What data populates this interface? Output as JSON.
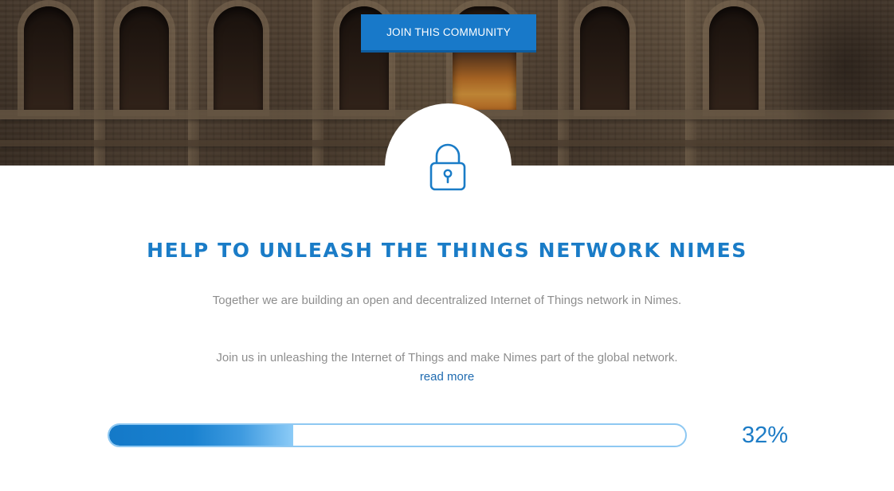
{
  "hero": {
    "join_button_label": "JOIN THIS COMMUNITY"
  },
  "badge": {
    "icon": "lock-icon"
  },
  "main": {
    "headline": "HELP TO UNLEASH THE THINGS NETWORK NIMES",
    "paragraph_1": "Together we are building an open and decentralized Internet of Things network in Nimes.",
    "paragraph_2": "Join us in unleashing the Internet of Things and make Nimes part of the global network.",
    "read_more_label": "read more"
  },
  "progress": {
    "percent": 32,
    "label": "32%"
  },
  "colors": {
    "accent": "#1a7cc7",
    "button": "#1879c9",
    "text_muted": "#8e8e8e",
    "link": "#1f6bb0",
    "progress_border": "#8ec8f2"
  }
}
